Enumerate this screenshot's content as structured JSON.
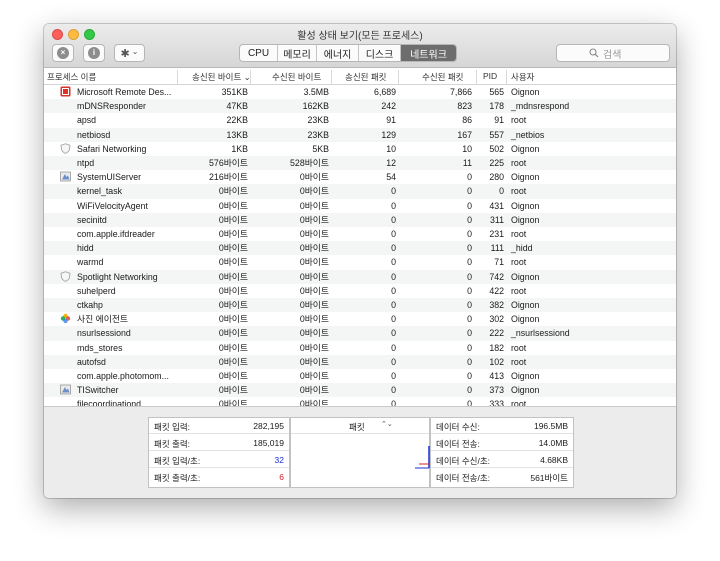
{
  "window": {
    "title": "활성 상태 보기(모든 프로세스)"
  },
  "toolbar": {
    "tabs": [
      {
        "label": "CPU",
        "active": false
      },
      {
        "label": "메모리",
        "active": false
      },
      {
        "label": "에너지",
        "active": false
      },
      {
        "label": "디스크",
        "active": false
      },
      {
        "label": "네트워크",
        "active": true
      }
    ],
    "search_placeholder": "검색",
    "info_glyph": "i",
    "close_glyph": "×",
    "gear_glyph": "✱",
    "chevron_glyph": "⌄"
  },
  "columns": {
    "process": "프로세스 이름",
    "sent_bytes": "송신된 바이트",
    "sort_glyph": "⌄",
    "recv_bytes": "수신된 바이트",
    "sent_packets": "송신된 패킷",
    "recv_packets": "수신된 패킷",
    "pid": "PID",
    "user": "사용자"
  },
  "processes": [
    {
      "name": "Microsoft Remote Des...",
      "sent": "351KB",
      "recv": "3.5MB",
      "sent_pk": "6,689",
      "recv_pk": "7,866",
      "pid": "565",
      "user": "Oignon",
      "icon": "remote-desktop"
    },
    {
      "name": "mDNSResponder",
      "sent": "47KB",
      "recv": "162KB",
      "sent_pk": "242",
      "recv_pk": "823",
      "pid": "178",
      "user": "_mdnsrespond",
      "icon": ""
    },
    {
      "name": "apsd",
      "sent": "22KB",
      "recv": "23KB",
      "sent_pk": "91",
      "recv_pk": "86",
      "pid": "91",
      "user": "root",
      "icon": ""
    },
    {
      "name": "netbiosd",
      "sent": "13KB",
      "recv": "23KB",
      "sent_pk": "129",
      "recv_pk": "167",
      "pid": "557",
      "user": "_netbios",
      "icon": ""
    },
    {
      "name": "Safari Networking",
      "sent": "1KB",
      "recv": "5KB",
      "sent_pk": "10",
      "recv_pk": "10",
      "pid": "502",
      "user": "Oignon",
      "icon": "shield"
    },
    {
      "name": "ntpd",
      "sent": "576바이트",
      "recv": "528바이트",
      "sent_pk": "12",
      "recv_pk": "11",
      "pid": "225",
      "user": "root",
      "icon": ""
    },
    {
      "name": "SystemUIServer",
      "sent": "216바이트",
      "recv": "0바이트",
      "sent_pk": "54",
      "recv_pk": "0",
      "pid": "280",
      "user": "Oignon",
      "icon": "app"
    },
    {
      "name": "kernel_task",
      "sent": "0바이트",
      "recv": "0바이트",
      "sent_pk": "0",
      "recv_pk": "0",
      "pid": "0",
      "user": "root",
      "icon": ""
    },
    {
      "name": "WiFiVelocityAgent",
      "sent": "0바이트",
      "recv": "0바이트",
      "sent_pk": "0",
      "recv_pk": "0",
      "pid": "431",
      "user": "Oignon",
      "icon": ""
    },
    {
      "name": "secinitd",
      "sent": "0바이트",
      "recv": "0바이트",
      "sent_pk": "0",
      "recv_pk": "0",
      "pid": "311",
      "user": "Oignon",
      "icon": ""
    },
    {
      "name": "com.apple.ifdreader",
      "sent": "0바이트",
      "recv": "0바이트",
      "sent_pk": "0",
      "recv_pk": "0",
      "pid": "231",
      "user": "root",
      "icon": ""
    },
    {
      "name": "hidd",
      "sent": "0바이트",
      "recv": "0바이트",
      "sent_pk": "0",
      "recv_pk": "0",
      "pid": "111",
      "user": "_hidd",
      "icon": ""
    },
    {
      "name": "warmd",
      "sent": "0바이트",
      "recv": "0바이트",
      "sent_pk": "0",
      "recv_pk": "0",
      "pid": "71",
      "user": "root",
      "icon": ""
    },
    {
      "name": "Spotlight Networking",
      "sent": "0바이트",
      "recv": "0바이트",
      "sent_pk": "0",
      "recv_pk": "0",
      "pid": "742",
      "user": "Oignon",
      "icon": "shield"
    },
    {
      "name": "suhelperd",
      "sent": "0바이트",
      "recv": "0바이트",
      "sent_pk": "0",
      "recv_pk": "0",
      "pid": "422",
      "user": "root",
      "icon": ""
    },
    {
      "name": "ctkahp",
      "sent": "0바이트",
      "recv": "0바이트",
      "sent_pk": "0",
      "recv_pk": "0",
      "pid": "382",
      "user": "Oignon",
      "icon": ""
    },
    {
      "name": "사진 에이전트",
      "sent": "0바이트",
      "recv": "0바이트",
      "sent_pk": "0",
      "recv_pk": "0",
      "pid": "302",
      "user": "Oignon",
      "icon": "photos"
    },
    {
      "name": "nsurlsessiond",
      "sent": "0바이트",
      "recv": "0바이트",
      "sent_pk": "0",
      "recv_pk": "0",
      "pid": "222",
      "user": "_nsurlsessiond",
      "icon": ""
    },
    {
      "name": "mds_stores",
      "sent": "0바이트",
      "recv": "0바이트",
      "sent_pk": "0",
      "recv_pk": "0",
      "pid": "182",
      "user": "root",
      "icon": ""
    },
    {
      "name": "autofsd",
      "sent": "0바이트",
      "recv": "0바이트",
      "sent_pk": "0",
      "recv_pk": "0",
      "pid": "102",
      "user": "root",
      "icon": ""
    },
    {
      "name": "com.apple.photomom...",
      "sent": "0바이트",
      "recv": "0바이트",
      "sent_pk": "0",
      "recv_pk": "0",
      "pid": "413",
      "user": "Oignon",
      "icon": ""
    },
    {
      "name": "TISwitcher",
      "sent": "0바이트",
      "recv": "0바이트",
      "sent_pk": "0",
      "recv_pk": "0",
      "pid": "373",
      "user": "Oignon",
      "icon": "app"
    },
    {
      "name": "filecoordinationd",
      "sent": "0바이트",
      "recv": "0바이트",
      "sent_pk": "0",
      "recv_pk": "0",
      "pid": "333",
      "user": "root",
      "icon": ""
    }
  ],
  "footer": {
    "left_stats": [
      {
        "label": "패킷 입력:",
        "value": "282,195",
        "color": "#222222"
      },
      {
        "label": "패킷 출력:",
        "value": "185,019",
        "color": "#222222"
      },
      {
        "label": "패킷 입력/초:",
        "value": "32",
        "color": "#1b2fd6"
      },
      {
        "label": "패킷 출력/초:",
        "value": "6",
        "color": "#d62222"
      }
    ],
    "graph_selector": "패킷",
    "graph_selector_glyph": "⌃⌄",
    "right_stats": [
      {
        "label": "데이터 수신:",
        "value": "196.5MB"
      },
      {
        "label": "데이터 전송:",
        "value": "14.0MB"
      },
      {
        "label": "데이터 수신/초:",
        "value": "4.68KB"
      },
      {
        "label": "데이터 전송/초:",
        "value": "561바이트"
      }
    ]
  },
  "colors": {
    "in": "#1b2fd6",
    "out": "#d62222",
    "active_tab": "#6d6d6d"
  }
}
